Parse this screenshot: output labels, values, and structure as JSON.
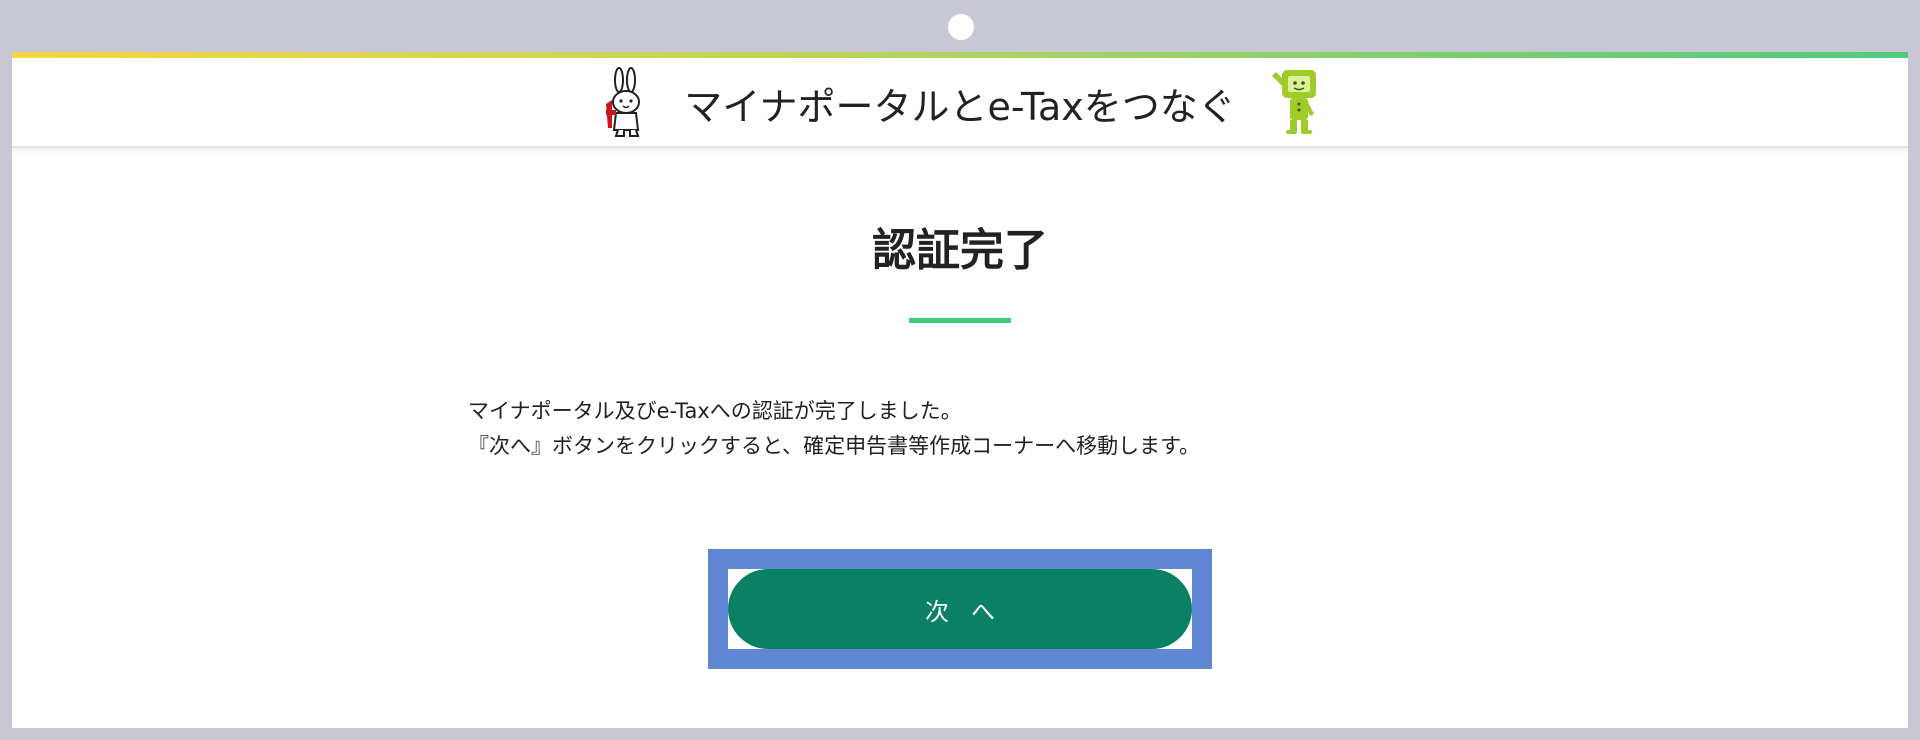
{
  "header": {
    "title": "マイナポータルとe-Taxをつなぐ",
    "left_mascot": "rabbit-mascot-icon",
    "right_mascot": "etax-mascot-icon"
  },
  "main": {
    "title": "認証完了",
    "message_lines": [
      "マイナポータル及びe-Taxへの認証が完了しました。",
      "『次へ』ボタンをクリックすると、確定申告書等作成コーナーへ移動します。"
    ],
    "next_button_label": "次へ"
  },
  "colors": {
    "button": "#0a8064",
    "highlight": "#5f87d4",
    "underline": "#3ecf7a",
    "frame": "#c8c8d4"
  }
}
